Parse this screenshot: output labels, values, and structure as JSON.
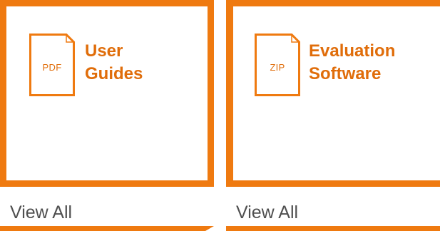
{
  "cards": [
    {
      "file_ext": "PDF",
      "title_lines": [
        "User",
        "Guides"
      ],
      "link_label": "View All"
    },
    {
      "file_ext": "ZIP",
      "title_lines": [
        "Evaluation",
        "Software"
      ],
      "link_label": "View All"
    }
  ],
  "colors": {
    "accent": "#ef7a10",
    "accent_text": "#e06d0a",
    "link_text": "#4f4f4f"
  },
  "icons": [
    "file-pdf-icon",
    "file-zip-icon"
  ]
}
